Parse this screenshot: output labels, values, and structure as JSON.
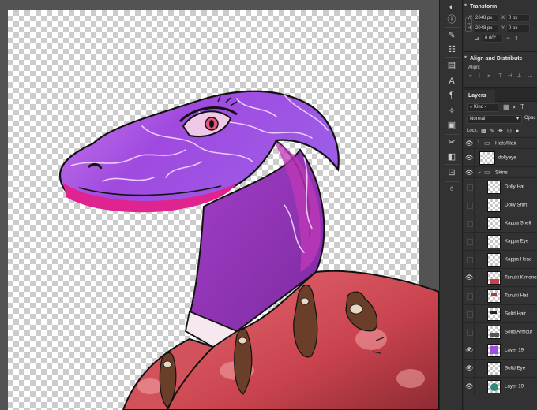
{
  "transform": {
    "title": "Transform",
    "w_label": "W",
    "w_value": "2048 px",
    "h_label": "H",
    "h_value": "2048 px",
    "x_label": "X",
    "x_value": "0 px",
    "y_label": "Y",
    "y_value": "0 px",
    "angle_value": "0.00°"
  },
  "align": {
    "title": "Align and Distribute",
    "align_label": "Align:"
  },
  "layers": {
    "tab_label": "Layers",
    "filter_kind": "Kind",
    "blend_mode": "Normal",
    "opacity_label": "Opac",
    "lock_label": "Lock:",
    "items": [
      {
        "name": "Hats/Hair",
        "type": "group",
        "visible": true,
        "expanded": false
      },
      {
        "name": "dollyeye",
        "type": "layer",
        "visible": true
      },
      {
        "name": "Skins",
        "type": "group",
        "visible": true,
        "expanded": true
      },
      {
        "name": "Dolly Hat",
        "type": "layer",
        "visible": false
      },
      {
        "name": "Dolly Shirt",
        "type": "layer",
        "visible": false
      },
      {
        "name": "Kappa Shell",
        "type": "layer",
        "visible": false
      },
      {
        "name": "Kappa Eye",
        "type": "layer",
        "visible": false
      },
      {
        "name": "Kappa Head",
        "type": "layer",
        "visible": false
      },
      {
        "name": "Tanuki Kimono",
        "type": "layer",
        "visible": true
      },
      {
        "name": "Tanuki Hat",
        "type": "layer",
        "visible": false
      },
      {
        "name": "Solid Hair",
        "type": "layer",
        "visible": false
      },
      {
        "name": "Solid Armour",
        "type": "layer",
        "visible": false
      },
      {
        "name": "Layer 19",
        "type": "layer",
        "visible": true
      },
      {
        "name": "Solid Eye",
        "type": "layer",
        "visible": true
      },
      {
        "name": "Layer 19",
        "type": "layer",
        "visible": true
      }
    ]
  },
  "colors": {
    "canvas_bg": "#535353",
    "panel_bg": "#323232",
    "skin_purple": "#a24be0",
    "kimono_red": "#d9535d"
  }
}
